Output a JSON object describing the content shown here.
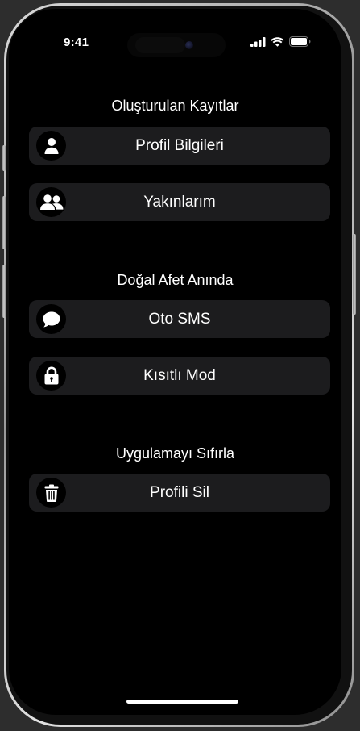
{
  "status_bar": {
    "time": "9:41"
  },
  "sections": [
    {
      "title": "Oluşturulan Kayıtlar",
      "items": [
        {
          "label": "Profil Bilgileri",
          "icon": "person-icon"
        },
        {
          "label": "Yakınlarım",
          "icon": "people-icon"
        }
      ]
    },
    {
      "title": "Doğal Afet Anında",
      "items": [
        {
          "label": "Oto SMS",
          "icon": "chat-bubble-icon"
        },
        {
          "label": "Kısıtlı Mod",
          "icon": "lock-icon"
        }
      ]
    },
    {
      "title": "Uygulamayı Sıfırla",
      "items": [
        {
          "label": "Profili Sil",
          "icon": "trash-icon"
        }
      ]
    }
  ],
  "colors": {
    "background": "#000000",
    "row_background": "#1c1c1e",
    "text": "#ffffff"
  }
}
